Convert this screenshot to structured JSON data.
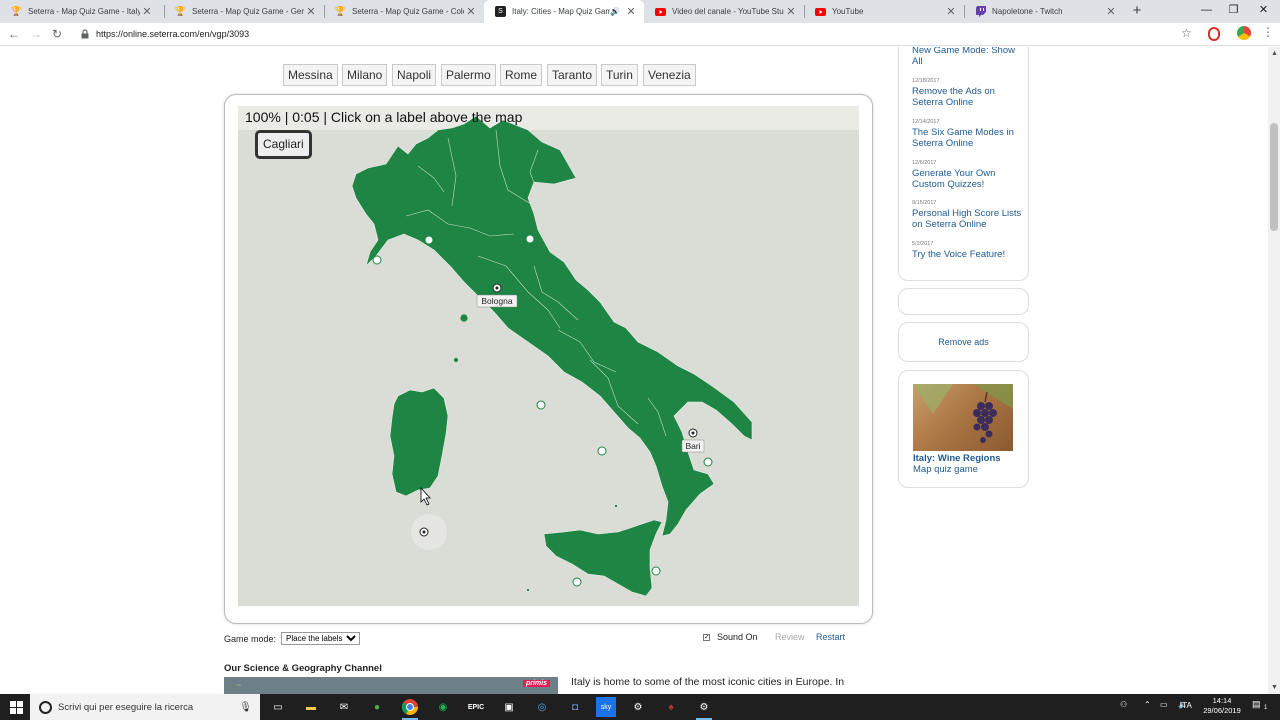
{
  "browser": {
    "tabs": [
      {
        "title": "Seterra - Map Quiz Game - Italy",
        "icon": "trophy-icon",
        "active": false
      },
      {
        "title": "Seterra - Map Quiz Game - Germ",
        "icon": "trophy-icon",
        "active": false
      },
      {
        "title": "Seterra - Map Quiz Game - Colo",
        "icon": "trophy-icon",
        "active": false
      },
      {
        "title": "Italy: Cities - Map Quiz Game",
        "icon": "seterra-icon",
        "active": true
      },
      {
        "title": "Video del canale - YouTube Stud",
        "icon": "youtube-icon",
        "active": false
      },
      {
        "title": "YouTube",
        "icon": "youtube-icon",
        "active": false
      },
      {
        "title": "Napoletone - Twitch",
        "icon": "twitch-icon",
        "active": false
      }
    ],
    "url": "https://online.seterra.com/en/vgp/3093"
  },
  "game": {
    "labels": [
      "Messina",
      "Milano",
      "Napoli",
      "Palermo",
      "Rome",
      "Taranto",
      "Turin",
      "Venezia"
    ],
    "score": "100%",
    "timer": "0:05",
    "instruction": "Click on a label above the map",
    "separator": "|",
    "current_label": "Cagliari",
    "placed": [
      "Bologna",
      "Bari"
    ],
    "land_color": "#1e8545",
    "sea_color": "#dadcd6"
  },
  "controls": {
    "game_mode_label": "Game mode:",
    "game_mode_value": "Place the labels",
    "sound_label": "Sound On",
    "sound_checked": true,
    "review": "Review",
    "restart": "Restart"
  },
  "below": {
    "channel_heading": "Our Science & Geography Channel",
    "video_badge": "primis",
    "intro_text": "Italy is home to some of the most iconic cities in Europe. In"
  },
  "sidebar": {
    "news": [
      {
        "date": "",
        "title": "New Game Mode: Show All"
      },
      {
        "date": "12/18/2017",
        "title": "Remove the Ads on Seterra Online"
      },
      {
        "date": "12/14/2017",
        "title": "The Six Game Modes in Seterra Online"
      },
      {
        "date": "12/6/2017",
        "title": "Generate Your Own Custom Quizzes!"
      },
      {
        "date": "9/15/2017",
        "title": "Personal High Score Lists on Seterra Online"
      },
      {
        "date": "5/2/2017",
        "title": "Try the Voice Feature!"
      }
    ],
    "remove_ads": "Remove ads",
    "promo": {
      "title": "Italy: Wine Regions",
      "subtitle": "Map quiz game"
    }
  },
  "taskbar": {
    "search_placeholder": "Scrivi qui per eseguire la ricerca",
    "language": "ITA",
    "time": "14:14",
    "date": "29/06/2019",
    "notifications": "1"
  }
}
